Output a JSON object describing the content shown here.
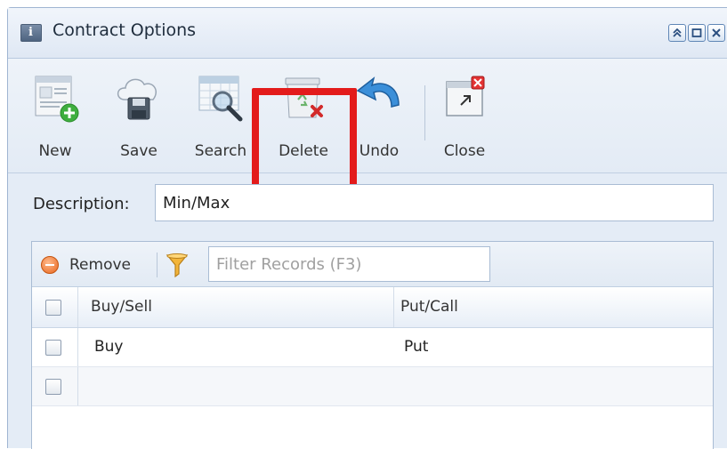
{
  "window": {
    "title": "Contract Options",
    "controls": [
      "restore",
      "maximize",
      "close"
    ]
  },
  "toolbar": {
    "new_label": "New",
    "save_label": "Save",
    "search_label": "Search",
    "delete_label": "Delete",
    "undo_label": "Undo",
    "close_label": "Close",
    "highlighted_button": "Delete",
    "highlight_color": "#e31b1b"
  },
  "form": {
    "description_label": "Description:",
    "description_value": "Min/Max"
  },
  "grid": {
    "remove_label": "Remove",
    "filter_placeholder": "Filter Records (F3)",
    "columns": [
      "Buy/Sell",
      "Put/Call"
    ],
    "rows": [
      {
        "buy_sell": "Buy",
        "put_call": "Put"
      },
      {
        "buy_sell": "",
        "put_call": ""
      }
    ]
  }
}
